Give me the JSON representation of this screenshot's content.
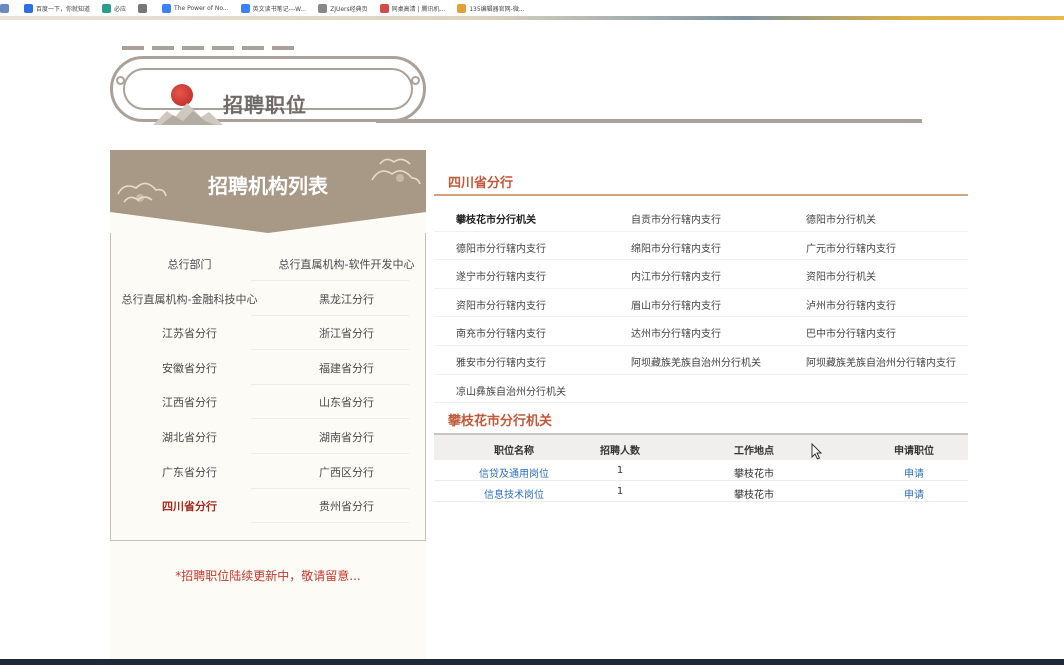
{
  "browser": {
    "bookmarks": [
      {
        "icon": "globe-icon",
        "label": "",
        "color": "#6a8bbf"
      },
      {
        "icon": "baidu-icon",
        "label": "百度一下，你就知道",
        "color": "#2f6fe0"
      },
      {
        "icon": "bing-icon",
        "label": "必应",
        "color": "#2a9d8f"
      },
      {
        "icon": "search-icon",
        "label": "",
        "color": "#777777"
      },
      {
        "icon": "page-icon",
        "label": "The Power of No...",
        "color": "#3b82f6"
      },
      {
        "icon": "page-icon",
        "label": "英文读书笔记---W...",
        "color": "#3b82f6"
      },
      {
        "icon": "doc-icon",
        "label": "ZJUers经典页",
        "color": "#888888"
      },
      {
        "icon": "page-icon",
        "label": "同桌高清 | 腾讯机...",
        "color": "#d14b4b"
      },
      {
        "icon": "page-icon",
        "label": "135编辑器官网-微...",
        "color": "#e0a13a"
      }
    ]
  },
  "banner": {
    "title": "招聘职位"
  },
  "left_panel": {
    "title": "招聘机构列表",
    "orgs": [
      [
        "总行部门",
        "总行直属机构-软件开发中心"
      ],
      [
        "总行直属机构-金融科技中心",
        "黑龙江分行"
      ],
      [
        "江苏省分行",
        "浙江省分行"
      ],
      [
        "安徽省分行",
        "福建省分行"
      ],
      [
        "江西省分行",
        "山东省分行"
      ],
      [
        "湖北省分行",
        "湖南省分行"
      ],
      [
        "广东省分行",
        "广西区分行"
      ],
      [
        "四川省分行",
        "贵州省分行"
      ]
    ],
    "active_org": "四川省分行",
    "update_note": "*招聘职位陆续更新中，敬请留意..."
  },
  "section": {
    "title": "四川省分行",
    "branches": [
      [
        "攀枝花市分行机关",
        "自贡市分行辖内支行",
        "德阳市分行机关"
      ],
      [
        "德阳市分行辖内支行",
        "绵阳市分行辖内支行",
        "广元市分行辖内支行"
      ],
      [
        "遂宁市分行辖内支行",
        "内江市分行辖内支行",
        "资阳市分行机关"
      ],
      [
        "资阳市分行辖内支行",
        "眉山市分行辖内支行",
        "泸州市分行辖内支行"
      ],
      [
        "南充市分行辖内支行",
        "达州市分行辖内支行",
        "巴中市分行辖内支行"
      ],
      [
        "雅安市分行辖内支行",
        "阿坝藏族羌族自治州分行机关",
        "阿坝藏族羌族自治州分行辖内支行"
      ],
      [
        "凉山彝族自治州分行机关"
      ]
    ],
    "active_branch": "攀枝花市分行机关"
  },
  "jobs": {
    "title": "攀枝花市分行机关",
    "headers": [
      "职位名称",
      "招聘人数",
      "工作地点",
      "申请职位"
    ],
    "rows": [
      {
        "name": "信贷及通用岗位",
        "count": "1",
        "location": "攀枝花市",
        "action": "申请"
      },
      {
        "name": "信息技术岗位",
        "count": "1",
        "location": "攀枝花市",
        "action": "申请"
      }
    ]
  },
  "colors": {
    "accent": "#c0593a",
    "active_org": "#a32a1f",
    "link": "#2f6fb8",
    "frame": "#a9a19a",
    "header_brown": "#a89886"
  }
}
